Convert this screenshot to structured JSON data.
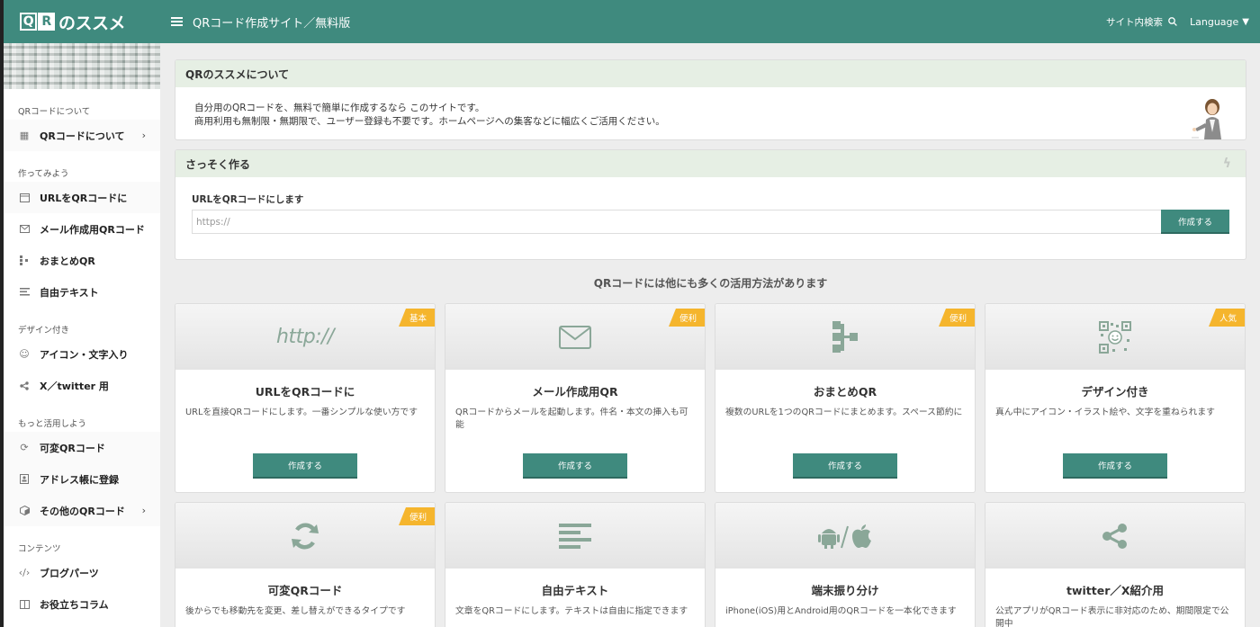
{
  "logo": {
    "q": "Q",
    "r": "R",
    "rest": "のススメ"
  },
  "header": {
    "title": "QRコード作成サイト／無料版",
    "search": "サイト内検索",
    "language": "Language"
  },
  "sidebar": {
    "sections": [
      {
        "label": "QRコードについて",
        "items": [
          {
            "label": "QRコードについて",
            "icon": "qr-icon",
            "chevron": "›"
          }
        ]
      },
      {
        "label": "作ってみよう",
        "items": [
          {
            "label": "URLをQRコードに",
            "icon": "window-icon"
          },
          {
            "label": "メール作成用QRコード",
            "icon": "mail-icon"
          },
          {
            "label": "おまとめQR",
            "icon": "sitemap-icon"
          },
          {
            "label": "自由テキスト",
            "icon": "text-icon"
          }
        ]
      },
      {
        "label": "デザイン付き",
        "items": [
          {
            "label": "アイコン・文字入り",
            "icon": "smile-icon"
          },
          {
            "label": "X／twitter 用",
            "icon": "share-icon"
          }
        ]
      },
      {
        "label": "もっと活用しよう",
        "items": [
          {
            "label": "可変QRコード",
            "icon": "refresh-icon"
          },
          {
            "label": "アドレス帳に登録",
            "icon": "address-book-icon"
          },
          {
            "label": "その他のQRコード",
            "icon": "box-icon",
            "chevron": "›"
          }
        ]
      },
      {
        "label": "コンテンツ",
        "items": [
          {
            "label": "ブログパーツ",
            "icon": "code-icon"
          },
          {
            "label": "お役立ちコラム",
            "icon": "column-icon"
          }
        ]
      }
    ]
  },
  "about": {
    "title": "QRのススメについて",
    "line1": "自分用のQRコードを、無料で簡単に作成するなら このサイトです。",
    "line2": "商用利用も無制限・無期限で、ユーザー登録も不要です。ホームページへの集客などに幅広くご活用ください。"
  },
  "quick": {
    "title": "さっそく作る",
    "label": "URLをQRコードにします",
    "placeholder": "https://",
    "button": "作成する"
  },
  "more_title": "QRコードには他にも多くの活用方法があります",
  "cards": [
    {
      "title": "URLをQRコードに",
      "desc": "URLを直接QRコードにします。一番シンプルな使い方です",
      "badge": "基本",
      "icon": "http-icon",
      "icon_text": "http://",
      "button": "作成する"
    },
    {
      "title": "メール作成用QR",
      "desc": "QRコードからメールを起動します。件名・本文の挿入も可能",
      "badge": "便利",
      "icon": "mail-icon",
      "button": "作成する"
    },
    {
      "title": "おまとめQR",
      "desc": "複数のURLを1つのQRコードにまとめます。スペース節約に",
      "badge": "便利",
      "icon": "sitemap-icon",
      "button": "作成する"
    },
    {
      "title": "デザイン付き",
      "desc": "真ん中にアイコン・イラスト絵や、文字を重ねられます",
      "badge": "人気",
      "icon": "qr-smile-icon",
      "button": "作成する"
    },
    {
      "title": "可変QRコード",
      "desc": "後からでも移動先を変更、差し替えができるタイプです",
      "badge": "便利",
      "icon": "refresh-icon"
    },
    {
      "title": "自由テキスト",
      "desc": "文章をQRコードにします。テキストは自由に指定できます",
      "badge": "",
      "icon": "text-icon"
    },
    {
      "title": "端末振り分け",
      "desc": "iPhone(iOS)用とAndroid用のQRコードを一本化できます",
      "badge": "",
      "icon": "android-apple-icon"
    },
    {
      "title": "twitter／X紹介用",
      "desc": "公式アプリがQRコード表示に非対応のため、期間限定で公開中",
      "badge": "",
      "icon": "share-icon"
    }
  ],
  "colors": {
    "brand": "#3f8a7e",
    "badge": "#f5b52d",
    "panel_head": "#e6efe4",
    "icon": "#8aa798"
  }
}
